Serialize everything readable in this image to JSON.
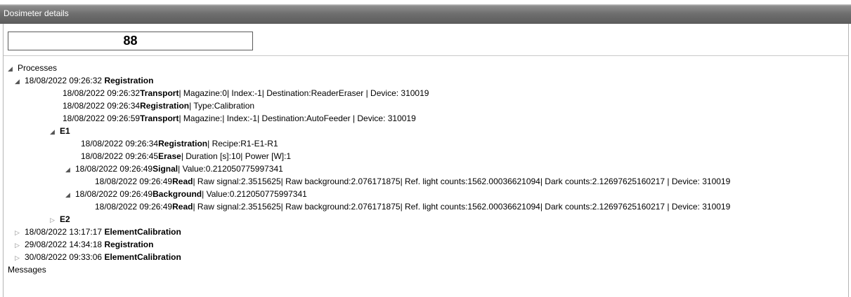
{
  "window": {
    "title": "Dosimeter details"
  },
  "dosimeter": {
    "id": "88"
  },
  "tree": {
    "processes_label": "Processes",
    "messages_label": "Messages",
    "p1": {
      "date": "18/08/2022 09:26:32",
      "name": "Registration",
      "events": [
        {
          "date": "18/08/2022 09:26:32",
          "type": "Transport",
          "detail": "| Magazine:0| Index:-1| Destination:ReaderEraser | Device: 310019"
        },
        {
          "date": "18/08/2022 09:26:34",
          "type": "Registration",
          "detail": "| Type:Calibration"
        },
        {
          "date": "18/08/2022 09:26:59",
          "type": "Transport",
          "detail": "| Magazine:| Index:-1| Destination:AutoFeeder | Device: 310019"
        }
      ],
      "e1": {
        "label": "E1",
        "events": [
          {
            "date": "18/08/2022 09:26:34",
            "type": "Registration",
            "detail": "| Recipe:R1-E1-R1"
          },
          {
            "date": "18/08/2022 09:26:45",
            "type": "Erase",
            "detail": "| Duration [s]:10| Power [W]:1"
          }
        ],
        "signal": {
          "date": "18/08/2022 09:26:49",
          "type": "Signal",
          "detail": "| Value:0.212050775997341",
          "read": {
            "date": "18/08/2022 09:26:49",
            "type": "Read",
            "detail": "| Raw signal:2.3515625| Raw background:2.076171875| Ref. light counts:1562.00036621094| Dark counts:2.12697625160217 | Device: 310019"
          }
        },
        "background": {
          "date": "18/08/2022 09:26:49",
          "type": "Background",
          "detail": "| Value:0.212050775997341",
          "read": {
            "date": "18/08/2022 09:26:49",
            "type": "Read",
            "detail": "| Raw signal:2.3515625| Raw background:2.076171875| Ref. light counts:1562.00036621094| Dark counts:2.12697625160217 | Device: 310019"
          }
        }
      },
      "e2": {
        "label": "E2"
      }
    },
    "p2": {
      "date": "18/08/2022 13:17:17",
      "name": "ElementCalibration"
    },
    "p3": {
      "date": "29/08/2022 14:34:18",
      "name": "Registration"
    },
    "p4": {
      "date": "30/08/2022 09:33:06",
      "name": "ElementCalibration"
    }
  },
  "icons": {
    "expanded": "triangle-expanded-icon",
    "collapsed": "triangle-collapsed-icon"
  }
}
